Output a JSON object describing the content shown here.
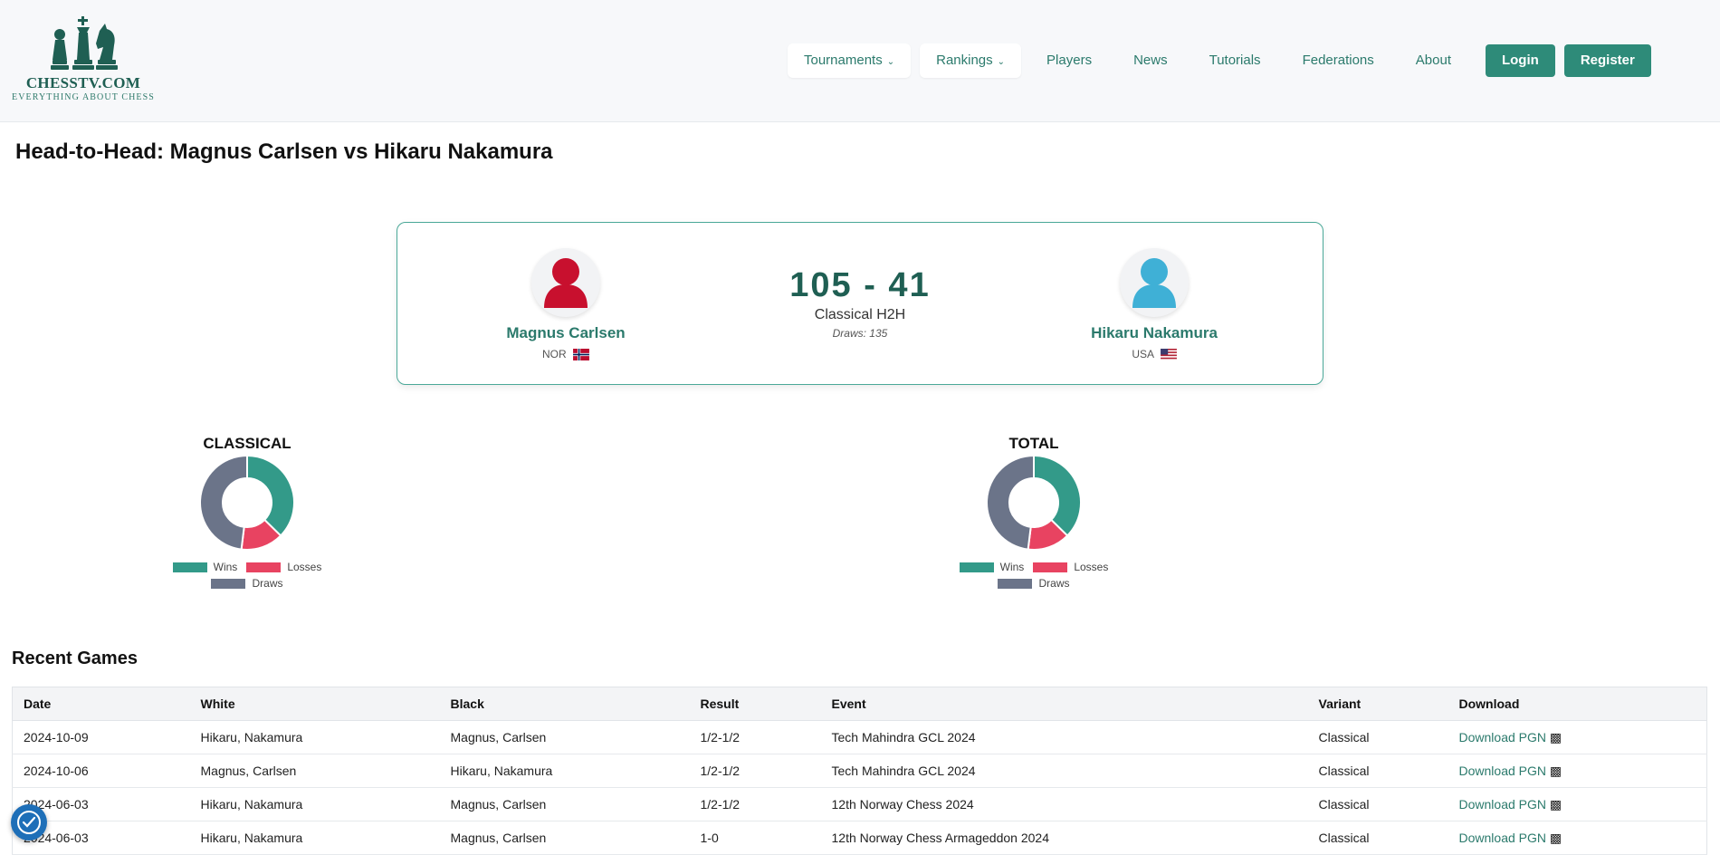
{
  "brand": {
    "name": "CHESSTV.COM",
    "tagline": "EVERYTHING ABOUT CHESS"
  },
  "nav": {
    "items": [
      {
        "label": "Tournaments",
        "dropdown": true
      },
      {
        "label": "Rankings",
        "dropdown": true
      },
      {
        "label": "Players",
        "dropdown": false
      },
      {
        "label": "News",
        "dropdown": false
      },
      {
        "label": "Tutorials",
        "dropdown": false
      },
      {
        "label": "Federations",
        "dropdown": false
      },
      {
        "label": "About",
        "dropdown": false
      }
    ],
    "login": "Login",
    "register": "Register"
  },
  "page": {
    "title": "Head-to-Head: Magnus Carlsen vs Hikaru Nakamura"
  },
  "h2h": {
    "player1": {
      "name": "Magnus Carlsen",
      "country": "NOR",
      "avatar_color": "#c8102e",
      "icon": "user-icon"
    },
    "player2": {
      "name": "Hikaru Nakamura",
      "country": "USA",
      "avatar_color": "#3fb0d6",
      "icon": "user-icon"
    },
    "score": "105 - 41",
    "label": "Classical H2H",
    "draws": "Draws: 135"
  },
  "chart_data": [
    {
      "type": "pie",
      "variant": "donut",
      "title": "CLASSICAL",
      "categories": [
        "Wins",
        "Losses",
        "Draws"
      ],
      "values": [
        105,
        41,
        135
      ],
      "colors": [
        "#339a89",
        "#e84361",
        "#6b7489"
      ],
      "legend": "bottom"
    },
    {
      "type": "pie",
      "variant": "donut",
      "title": "TOTAL",
      "categories": [
        "Wins",
        "Losses",
        "Draws"
      ],
      "values": [
        105,
        41,
        135
      ],
      "colors": [
        "#339a89",
        "#e84361",
        "#6b7489"
      ],
      "legend": "bottom"
    }
  ],
  "recent": {
    "title": "Recent Games",
    "columns": [
      "Date",
      "White",
      "Black",
      "Result",
      "Event",
      "Variant",
      "Download"
    ],
    "rows": [
      {
        "date": "2024-10-09",
        "white": "Hikaru, Nakamura",
        "black": "Magnus, Carlsen",
        "result": "1/2-1/2",
        "event": "Tech Mahindra GCL 2024",
        "variant": "Classical",
        "download": "Download PGN"
      },
      {
        "date": "2024-10-06",
        "white": "Magnus, Carlsen",
        "black": "Hikaru, Nakamura",
        "result": "1/2-1/2",
        "event": "Tech Mahindra GCL 2024",
        "variant": "Classical",
        "download": "Download PGN"
      },
      {
        "date": "2024-06-03",
        "white": "Hikaru, Nakamura",
        "black": "Magnus, Carlsen",
        "result": "1/2-1/2",
        "event": "12th Norway Chess 2024",
        "variant": "Classical",
        "download": "Download PGN"
      },
      {
        "date": "2024-06-03",
        "white": "Hikaru, Nakamura",
        "black": "Magnus, Carlsen",
        "result": "1-0",
        "event": "12th Norway Chess Armageddon 2024",
        "variant": "Classical",
        "download": "Download PGN"
      }
    ]
  }
}
